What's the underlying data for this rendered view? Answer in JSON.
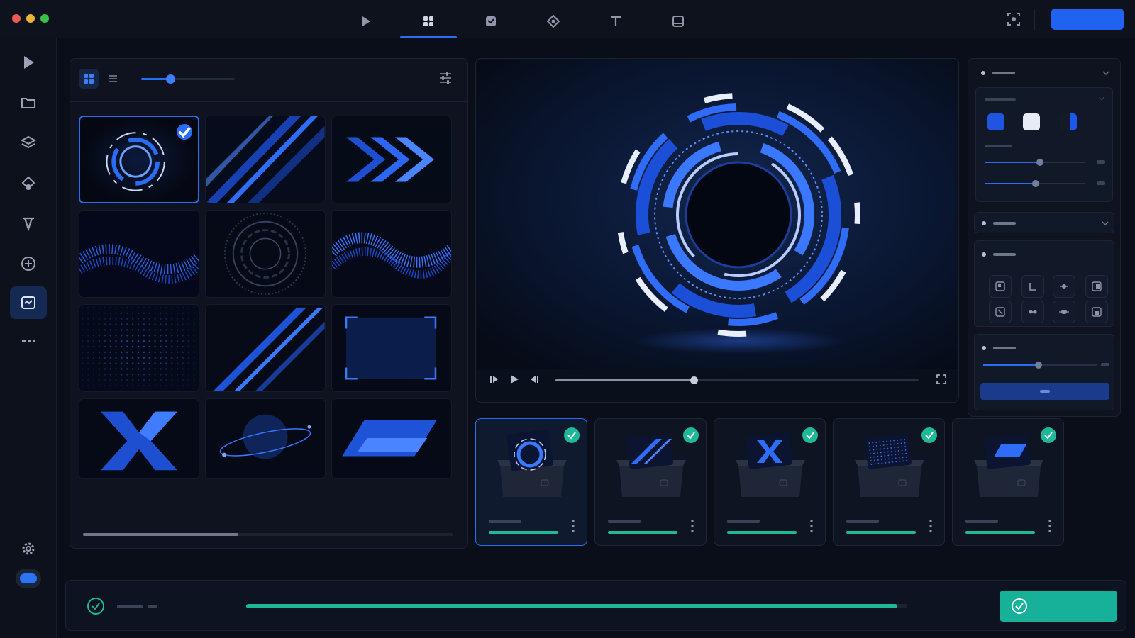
{
  "window": {
    "controls": [
      "close",
      "minimize",
      "maximize"
    ]
  },
  "toolbar": {
    "tabs": [
      {
        "icon": "play-icon"
      },
      {
        "icon": "grid-icon",
        "active": true
      },
      {
        "icon": "media-icon"
      },
      {
        "icon": "diamond-icon"
      },
      {
        "icon": "text-icon"
      },
      {
        "icon": "frame-icon"
      }
    ],
    "right_icon": "screen-capture-icon",
    "primary_button_color": "#1f63f0"
  },
  "sidebar": {
    "items": [
      {
        "icon": "play-icon"
      },
      {
        "icon": "folder-icon"
      },
      {
        "icon": "layers-icon"
      },
      {
        "icon": "shapes-icon"
      },
      {
        "icon": "font-icon"
      },
      {
        "icon": "add-circle-icon"
      },
      {
        "icon": "template-icon",
        "active": true
      },
      {
        "icon": "more-icon"
      }
    ],
    "bottom": [
      {
        "icon": "gear-icon"
      },
      {
        "icon": "toggle-icon"
      }
    ]
  },
  "library": {
    "view_modes": [
      "grid",
      "list"
    ],
    "active_view": "grid",
    "thumb_size": 0.3,
    "tiles": [
      {
        "name": "ring-orb",
        "selected": true
      },
      {
        "name": "light-streaks"
      },
      {
        "name": "chevrons"
      },
      {
        "name": "particle-wave"
      },
      {
        "name": "concentric-rings"
      },
      {
        "name": "ribbon-wave"
      },
      {
        "name": "dot-grid"
      },
      {
        "name": "diagonal-bars"
      },
      {
        "name": "frame-corners"
      },
      {
        "name": "x-mark"
      },
      {
        "name": "planet"
      },
      {
        "name": "parallelogram"
      }
    ],
    "scroll_position": 0.42
  },
  "preview": {
    "playhead": 0.38
  },
  "inspector": {
    "swatches": [
      "#1f55e0",
      "#e6ebf5",
      "#1c57ee"
    ],
    "slider_1": 0.55,
    "slider_2": 0.51,
    "slider_3": 0.49,
    "colors": {
      "accent": "#2a6df5",
      "panel": "#0e131f"
    }
  },
  "timeline": {
    "cards": [
      {
        "name": "card-ring",
        "done": true,
        "selected": true,
        "progress": 1.0
      },
      {
        "name": "card-streaks",
        "done": true,
        "progress": 1.0
      },
      {
        "name": "card-x",
        "done": true,
        "progress": 1.0
      },
      {
        "name": "card-grid",
        "done": true,
        "progress": 1.0
      },
      {
        "name": "card-shape",
        "done": true,
        "progress": 1.0
      }
    ]
  },
  "status": {
    "progress": 0.985,
    "complete_color": "#17b199"
  }
}
